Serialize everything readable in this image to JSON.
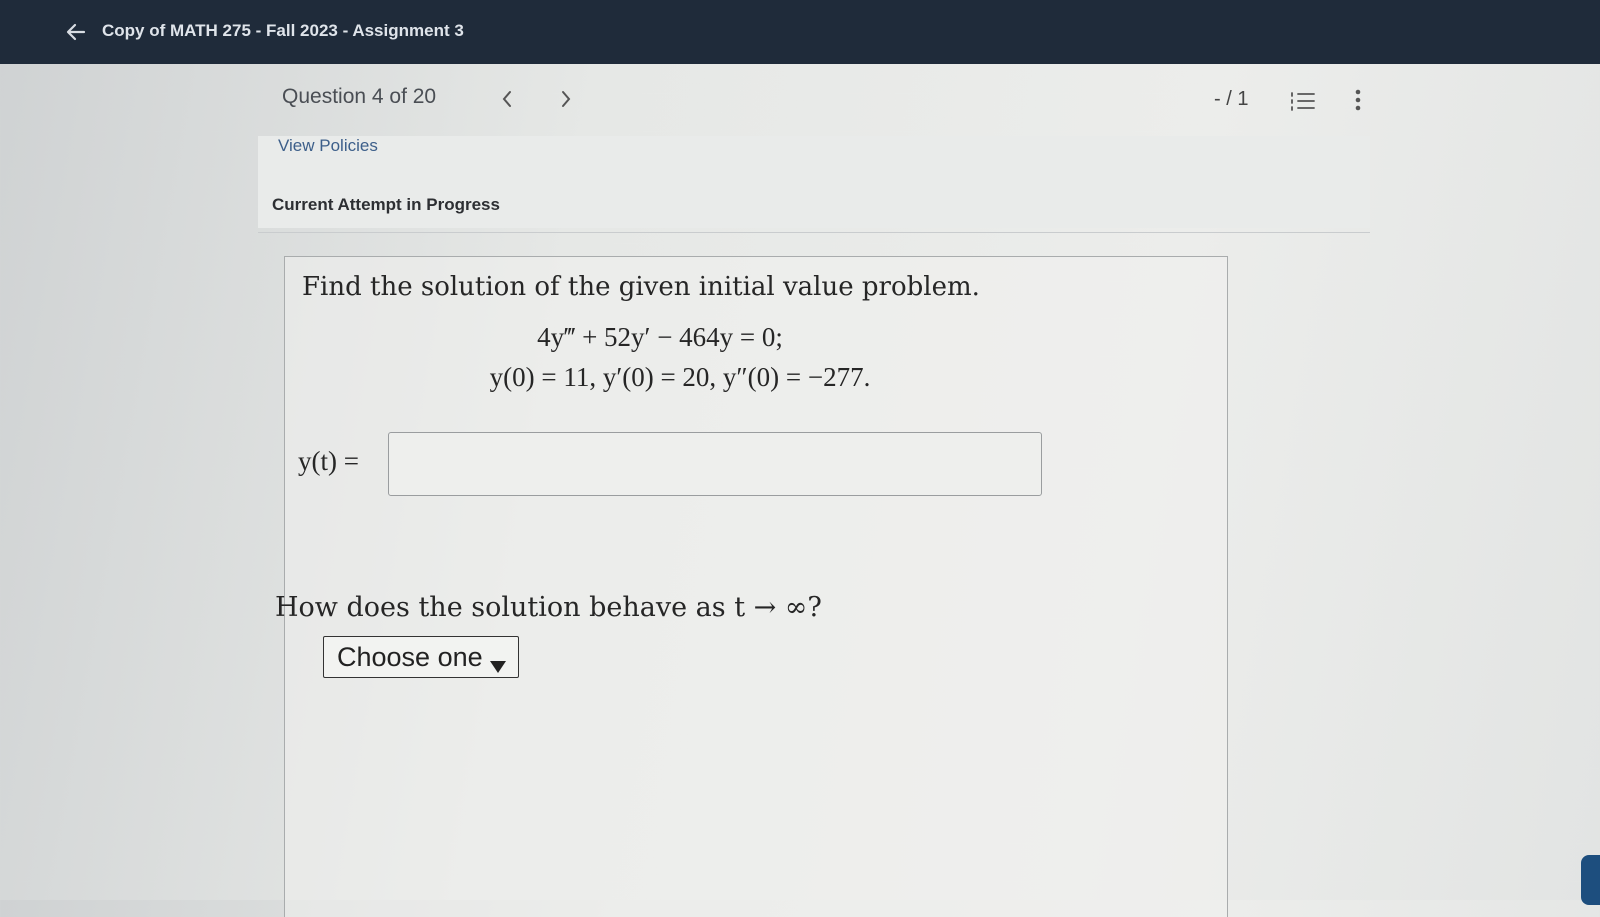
{
  "header": {
    "back_icon": "arrow-left-icon",
    "course_title": "Copy of MATH 275 - Fall 2023 - Assignment 3"
  },
  "toolbar": {
    "question_counter": "Question 4 of 20",
    "prev_icon": "chevron-left-icon",
    "next_icon": "chevron-right-icon",
    "score": "- / 1",
    "list_icon": "question-list-icon",
    "more_icon": "more-vertical-icon"
  },
  "links": {
    "view_policies": "View Policies"
  },
  "status": {
    "attempt": "Current Attempt in Progress"
  },
  "question": {
    "prompt": "Find the solution of the given initial value problem.",
    "equation_line1": "4y‴ + 52y′ − 464y = 0;",
    "equation_line2": "y(0) = 11,  y′(0) = 20,  y″(0) = −277.",
    "answer_label": "y(t) =",
    "answer_value": "",
    "behavior_question": "How does the solution behave as t → ∞?",
    "behavior_select_label": "Choose one"
  },
  "colors": {
    "header_bg": "#1f2b3a",
    "link": "#3d5f8a",
    "page_bg": "#e6e8e6"
  }
}
